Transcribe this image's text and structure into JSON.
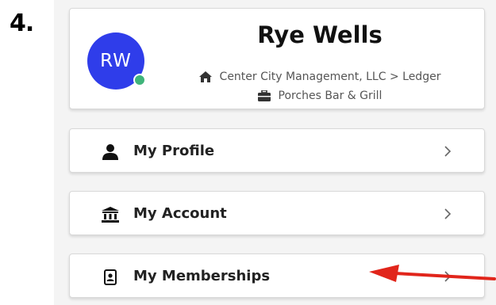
{
  "step": {
    "label": "4."
  },
  "profile": {
    "initials": "RW",
    "name": "Rye Wells",
    "organization": "Center City Management, LLC > Ledger",
    "venue": "Porches Bar & Grill",
    "avatar_color": "#2f3dea",
    "status_color": "#3fb47a"
  },
  "menu": [
    {
      "label": "My Profile",
      "icon": "person-icon"
    },
    {
      "label": "My Account",
      "icon": "bank-icon"
    },
    {
      "label": "My Memberships",
      "icon": "id-badge-icon"
    }
  ],
  "annotation": {
    "arrow_color": "#e1251b"
  }
}
